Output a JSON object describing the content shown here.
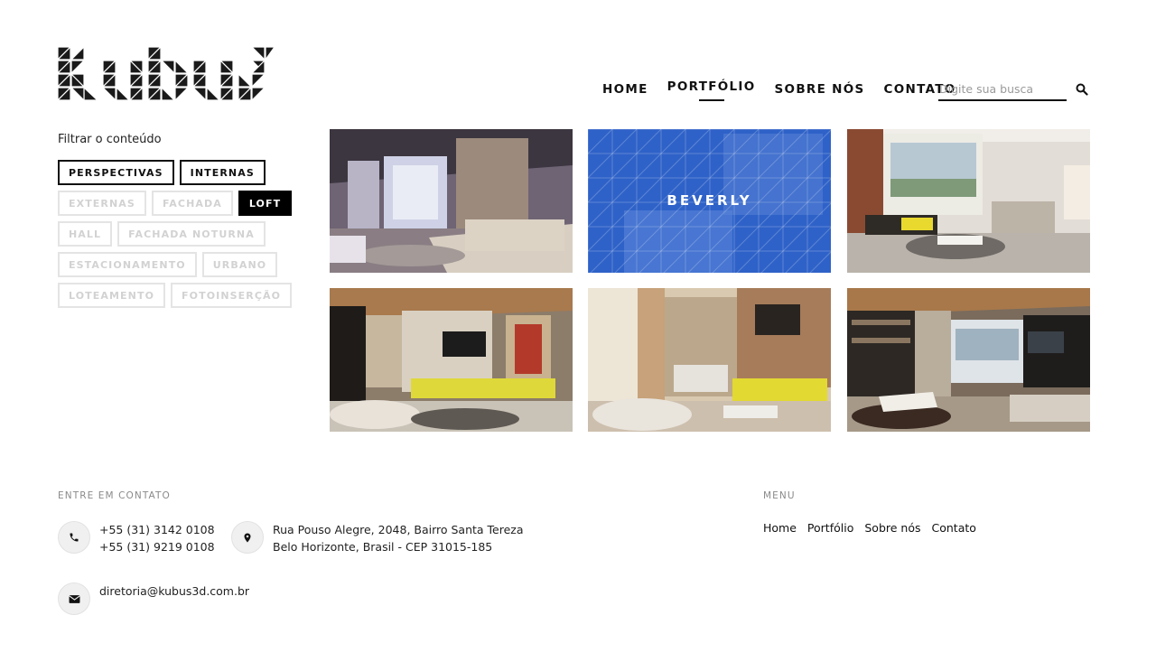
{
  "brand": {
    "logo_alt": "kubus"
  },
  "nav": {
    "items": [
      {
        "label": "HOME",
        "active": false
      },
      {
        "label": "PORTFÓLIO",
        "active": true
      },
      {
        "label": "SOBRE NÓS",
        "active": false
      },
      {
        "label": "CONTATO",
        "active": false
      }
    ],
    "search_placeholder": "Digite sua busca",
    "search_icon": "search-icon"
  },
  "filters": {
    "title": "Filtrar o conteúdo",
    "tags": [
      {
        "label": "PERSPECTIVAS",
        "state": "selected-outline"
      },
      {
        "label": "INTERNAS",
        "state": "selected-outline"
      },
      {
        "label": "EXTERNAS",
        "state": "inactive"
      },
      {
        "label": "FACHADA",
        "state": "inactive"
      },
      {
        "label": "LOFT",
        "state": "active"
      },
      {
        "label": "HALL",
        "state": "inactive"
      },
      {
        "label": "FACHADA NOTURNA",
        "state": "inactive"
      },
      {
        "label": "ESTACIONAMENTO",
        "state": "inactive"
      },
      {
        "label": "URBANO",
        "state": "inactive"
      },
      {
        "label": "LOTEAMENTO",
        "state": "inactive"
      },
      {
        "label": "FOTOINSERÇÃO",
        "state": "inactive"
      }
    ]
  },
  "gallery": {
    "hover_label": "BEVERLY",
    "overlay_color": "#2f62c8"
  },
  "footer": {
    "contact_label": "ENTRE EM CONTATO",
    "phone1": "+55 (31) 3142 0108",
    "phone2": "+55 (31) 9219 0108",
    "address1": "Rua Pouso Alegre, 2048, Bairro Santa Tereza",
    "address2": "Belo Horizonte, Brasil - CEP 31015-185",
    "email": "diretoria@kubus3d.com.br",
    "menu_label": "MENU",
    "menu": [
      "Home",
      "Portfólio",
      "Sobre nós",
      "Contato"
    ],
    "icons": [
      "phone-icon",
      "map-pin-icon",
      "envelope-icon"
    ]
  }
}
